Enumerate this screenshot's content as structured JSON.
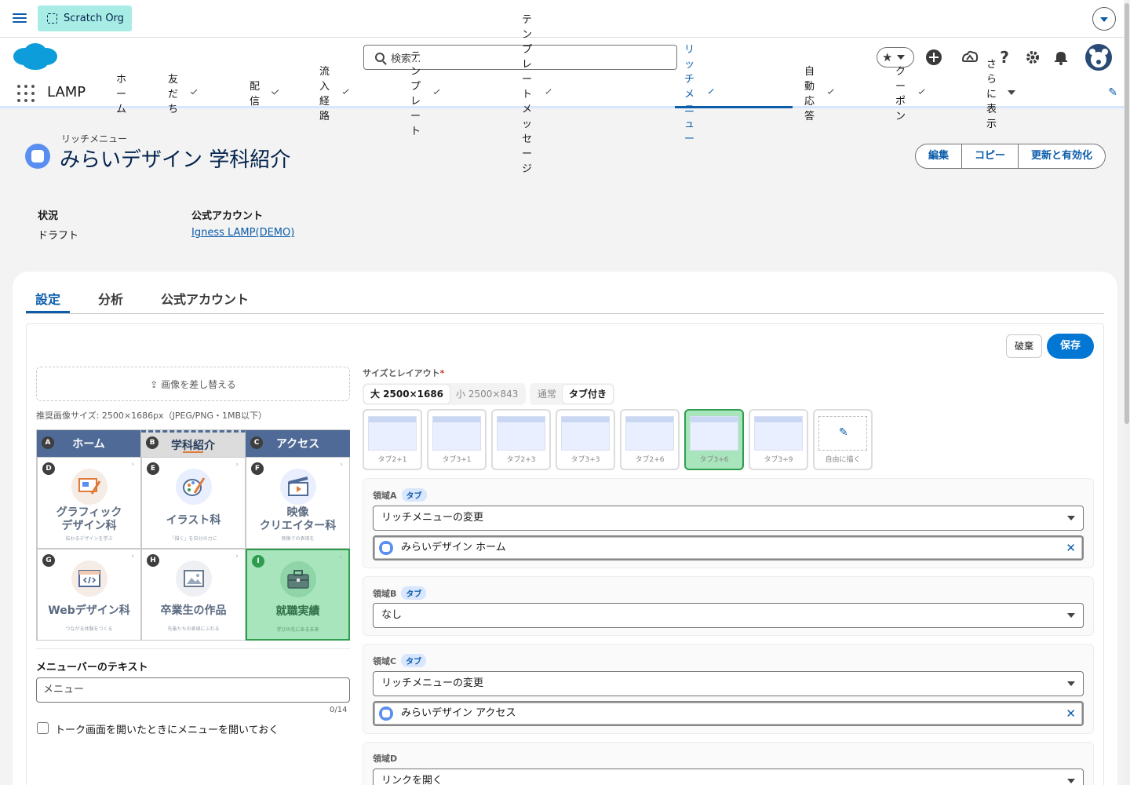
{
  "topbar": {
    "org_label": "Scratch Org"
  },
  "header": {
    "search_placeholder": "検索..."
  },
  "nav": {
    "app_name": "LAMP",
    "items": [
      {
        "label": "ホーム",
        "has_chevron": false
      },
      {
        "label": "友だち",
        "has_chevron": true
      },
      {
        "label": "配信",
        "has_chevron": true
      },
      {
        "label": "流入経路",
        "has_chevron": true
      },
      {
        "label": "テンプレート",
        "has_chevron": true
      },
      {
        "label": "テンプレートメッセージ",
        "has_chevron": true
      },
      {
        "label": "リッチメニュー",
        "has_chevron": true,
        "active": true
      },
      {
        "label": "自動応答",
        "has_chevron": true
      },
      {
        "label": "クーポン",
        "has_chevron": true
      }
    ],
    "more_label": "さらに表示"
  },
  "record": {
    "type_label": "リッチメニュー",
    "title": "みらいデザイン 学科紹介",
    "actions": [
      "編集",
      "コピー",
      "更新と有効化"
    ]
  },
  "fields": {
    "status_label": "状況",
    "status_value": "ドラフト",
    "account_label": "公式アカウント",
    "account_value": "Igness LAMP(DEMO)"
  },
  "tabs": [
    "設定",
    "分析",
    "公式アカウント"
  ],
  "form": {
    "discard_label": "破棄",
    "save_label": "保存",
    "replace_image_label": "⇪ 画像を差し替える",
    "image_hint": "推奨画像サイズ: 2500×1686px（JPEG/PNG・1MB以下）",
    "grid_tabs": [
      {
        "letter": "A",
        "label": "ホーム"
      },
      {
        "letter": "B",
        "label": "学科紹介"
      },
      {
        "letter": "C",
        "label": "アクセス"
      }
    ],
    "grid_cells": [
      {
        "letter": "D",
        "name1": "グラフィック",
        "name2": "デザイン科",
        "sub": "伝わるデザインを学ぶ",
        "icon": "monitor-pen-icon"
      },
      {
        "letter": "E",
        "name1": "イラスト科",
        "name2": "",
        "sub": "「描く」を自分の力に",
        "icon": "palette-icon"
      },
      {
        "letter": "F",
        "name1": "映像",
        "name2": "クリエイター科",
        "sub": "映像での表現を",
        "icon": "clapperboard-icon"
      },
      {
        "letter": "G",
        "name1": "Webデザイン科",
        "name2": "",
        "sub": "つながる体験をつくる",
        "icon": "code-window-icon"
      },
      {
        "letter": "H",
        "name1": "卒業生の作品",
        "name2": "",
        "sub": "先輩たちの表現にふれる",
        "icon": "image-icon"
      },
      {
        "letter": "I",
        "name1": "就職実績",
        "name2": "",
        "sub": "学びの先にある未来",
        "icon": "briefcase-icon"
      }
    ],
    "menubar_label": "メニューバーのテキスト",
    "menubar_value": "メニュー",
    "menubar_counter": "0/14",
    "open_menu_label": "トーク画面を開いたときにメニューを開いておく",
    "size_layout_label": "サイズとレイアウト",
    "size_options": [
      "大 2500×1686",
      "小 2500×843"
    ],
    "mode_options": [
      "通常",
      "タブ付き"
    ],
    "layouts": [
      "タブ2+1",
      "タブ3+1",
      "タブ2+3",
      "タブ3+3",
      "タブ2+6",
      "タブ3+6",
      "タブ3+9",
      "自由に描く"
    ],
    "regions": [
      {
        "label": "領域A",
        "badge": "タブ",
        "action": "リッチメニューの変更",
        "lookup": "みらいデザイン ホーム"
      },
      {
        "label": "領域B",
        "badge": "タブ",
        "action": "なし",
        "lookup": ""
      },
      {
        "label": "領域C",
        "badge": "タブ",
        "action": "リッチメニューの変更",
        "lookup": "みらいデザイン アクセス"
      },
      {
        "label": "領域D",
        "badge": "",
        "action": "リンクを開く",
        "lookup": ""
      }
    ]
  },
  "colors": {
    "brand_blue": "#0b5cab",
    "save_blue": "#0176d3",
    "selected_green": "#a8e5bd"
  }
}
